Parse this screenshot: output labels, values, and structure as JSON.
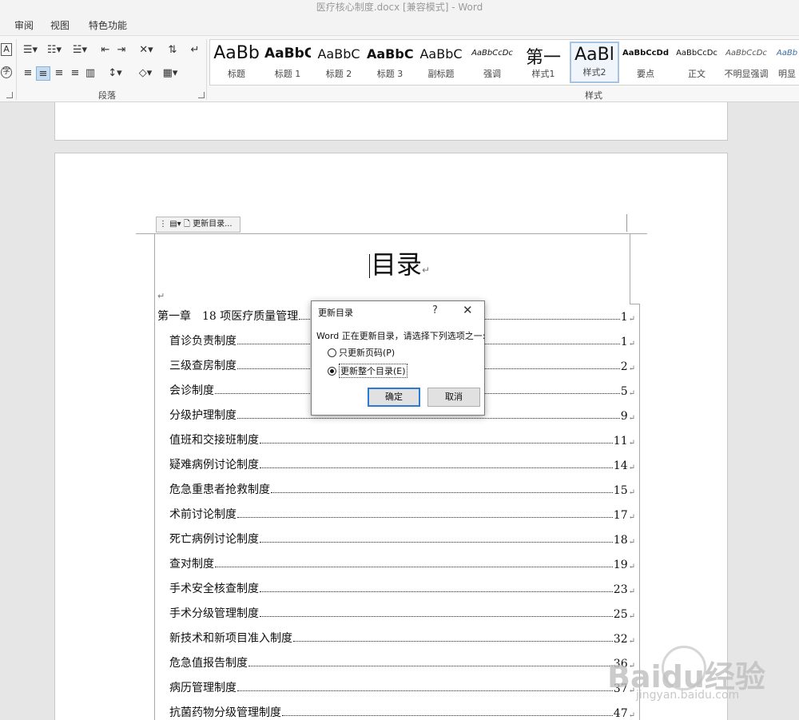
{
  "window": {
    "title": "医疗核心制度.docx [兼容模式] - Word"
  },
  "tabs": [
    "审阅",
    "视图",
    "特色功能"
  ],
  "ribbon": {
    "paragraph_group_label": "段落",
    "styles_group_label": "样式",
    "styles": [
      {
        "sample": "AaBb",
        "name": "标题"
      },
      {
        "sample": "AaBbC",
        "name": "标题 1"
      },
      {
        "sample": "AaBbC",
        "name": "标题 2"
      },
      {
        "sample": "AaBbC",
        "name": "标题 3"
      },
      {
        "sample": "AaBbC",
        "name": "副标题"
      },
      {
        "sample": "AaBbCcDc",
        "name": "强调"
      },
      {
        "sample": "第一",
        "name": "样式1"
      },
      {
        "sample": "AaBl",
        "name": "样式2"
      },
      {
        "sample": "AaBbCcDd",
        "name": "要点"
      },
      {
        "sample": "AaBbCcDc",
        "name": "正文"
      },
      {
        "sample": "AaBbCcDc",
        "name": "不明显强调"
      },
      {
        "sample": "AaBb",
        "name": "明显"
      }
    ]
  },
  "document": {
    "toc_tab_label": "更新目录...",
    "title": "目录",
    "para_mark": "↵",
    "toc": [
      {
        "label": "第一章　18 项医疗质量管理",
        "page": "1"
      },
      {
        "label": "首诊负责制度",
        "page": "1"
      },
      {
        "label": "三级查房制度",
        "page": "2"
      },
      {
        "label": "会诊制度",
        "page": "5"
      },
      {
        "label": "分级护理制度",
        "page": "9"
      },
      {
        "label": "值班和交接班制度",
        "page": "11"
      },
      {
        "label": "疑难病例讨论制度",
        "page": "14"
      },
      {
        "label": "危急重患者抢救制度",
        "page": "15"
      },
      {
        "label": "术前讨论制度",
        "page": "17"
      },
      {
        "label": "死亡病例讨论制度",
        "page": "18"
      },
      {
        "label": "查对制度",
        "page": "19"
      },
      {
        "label": "手术安全核查制度",
        "page": "23"
      },
      {
        "label": "手术分级管理制度",
        "page": "25"
      },
      {
        "label": "新技术和新项目准入制度",
        "page": "32"
      },
      {
        "label": "危急值报告制度",
        "page": "36"
      },
      {
        "label": "病历管理制度",
        "page": "37"
      },
      {
        "label": "抗菌药物分级管理制度",
        "page": "47"
      }
    ]
  },
  "dialog": {
    "title": "更新目录",
    "help": "?",
    "close": "✕",
    "prompt": "Word 正在更新目录，请选择下列选项之一:",
    "option1": "只更新页码(P)",
    "option2": "更新整个目录(E)",
    "ok": "确定",
    "cancel": "取消"
  },
  "watermark": {
    "text": "Baidu经验",
    "url": "jingyan.baidu.com"
  }
}
